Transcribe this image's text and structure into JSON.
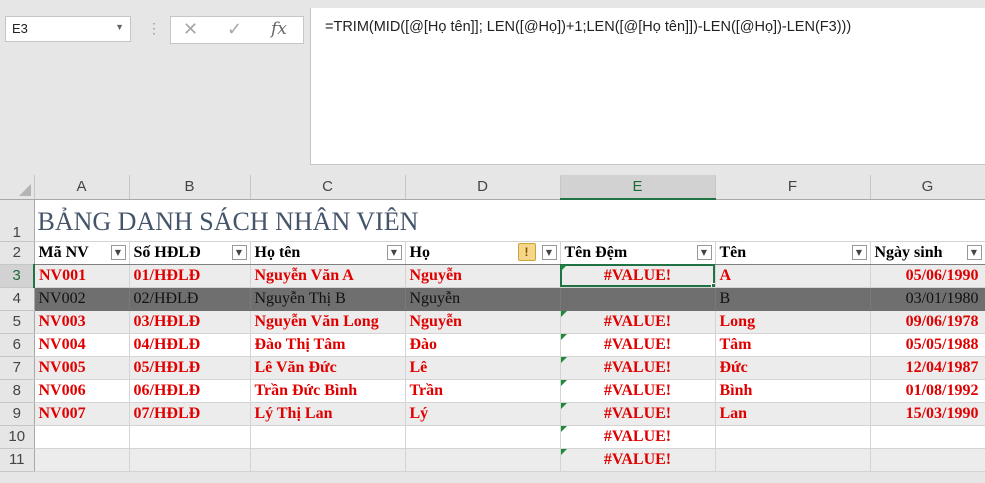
{
  "namebox": {
    "value": "E3"
  },
  "formula_bar": {
    "cancel_icon": "✕",
    "enter_icon": "✓",
    "fx_icon": "fx",
    "formula": "=TRIM(MID([@[Họ tên]]; LEN([@Họ])+1;LEN([@[Họ tên]])-LEN([@Họ])-LEN(F3)))"
  },
  "columns": [
    "A",
    "B",
    "C",
    "D",
    "E",
    "F",
    "G"
  ],
  "rows_numbers": [
    "1",
    "2",
    "3",
    "4",
    "5",
    "6",
    "7",
    "8",
    "9",
    "10",
    "11"
  ],
  "title": "BẢNG DANH SÁCH NHÂN VIÊN",
  "headers": [
    "Mã NV",
    "Số HĐLĐ",
    "Họ tên",
    "Họ",
    "Tên Đệm",
    "Tên",
    "Ngày sinh"
  ],
  "rows": [
    [
      "NV001",
      "01/HĐLĐ",
      "Nguyễn Văn A",
      "Nguyễn",
      "#VALUE!",
      "A",
      "05/06/1990"
    ],
    [
      "NV002",
      "02/HĐLĐ",
      "Nguyễn Thị B",
      "Nguyễn",
      "",
      "B",
      "03/01/1980"
    ],
    [
      "NV003",
      "03/HĐLĐ",
      "Nguyễn Văn Long",
      "Nguyễn",
      "#VALUE!",
      "Long",
      "09/06/1978"
    ],
    [
      "NV004",
      "04/HĐLĐ",
      "Đào Thị Tâm",
      "Đào",
      "#VALUE!",
      "Tâm",
      "05/05/1988"
    ],
    [
      "NV005",
      "05/HĐLĐ",
      "Lê Văn Đức",
      "Lê",
      "#VALUE!",
      "Đức",
      "12/04/1987"
    ],
    [
      "NV006",
      "06/HĐLĐ",
      "Trần Đức Bình",
      "Trần",
      "#VALUE!",
      "Bình",
      "01/08/1992"
    ],
    [
      "NV007",
      "07/HĐLĐ",
      "Lý Thị Lan",
      "Lý",
      "#VALUE!",
      "Lan",
      "15/03/1990"
    ],
    [
      "",
      "",
      "",
      "",
      "#VALUE!",
      "",
      ""
    ],
    [
      "",
      "",
      "",
      "",
      "#VALUE!",
      "",
      ""
    ]
  ],
  "colors": {
    "accent": "#217346",
    "error_text": "#e00000",
    "title": "#44546a",
    "selected_row": "#6f6f6f"
  }
}
